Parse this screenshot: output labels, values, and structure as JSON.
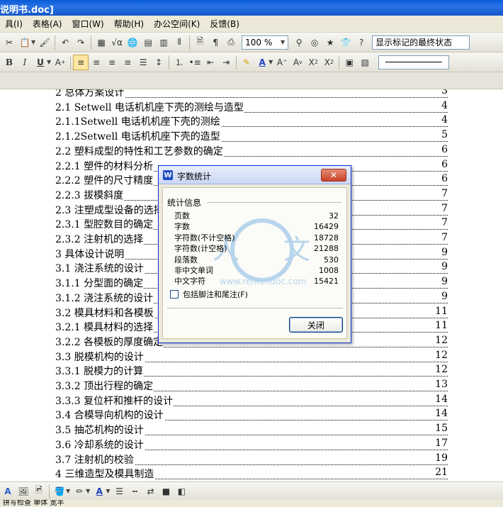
{
  "window": {
    "title": "说明书.doc]"
  },
  "menu": [
    "具(I)",
    "表格(A)",
    "窗口(W)",
    "帮助(H)",
    "办公空间(K)",
    "反馈(B)"
  ],
  "toolbar": {
    "zoom": "100 %",
    "markup_view": "显示标记的最终状态"
  },
  "toc": [
    {
      "text": "2 总体方案设计",
      "page": "3"
    },
    {
      "text": "2.1  Setwell 电话机机座下壳的测绘与造型",
      "page": "4"
    },
    {
      "text": "2.1.1Setwell 电话机机座下壳的测绘",
      "page": "4"
    },
    {
      "text": "2.1.2Setwell 电话机机座下壳的造型",
      "page": "5"
    },
    {
      "text": "2.2 塑料成型的特性和工艺参数的确定",
      "page": "6"
    },
    {
      "text": "2.2.1 塑件的材料分析",
      "page": "6"
    },
    {
      "text": "2.2.2 塑件的尺寸精度",
      "page": "6"
    },
    {
      "text": "2.2.3 拔模斜度",
      "page": "7"
    },
    {
      "text": "2.3 注塑成型设备的选择",
      "page": "7"
    },
    {
      "text": "2.3.1 型腔数目的确定",
      "page": "7"
    },
    {
      "text": "2.3.2 注射机的选择",
      "page": "7"
    },
    {
      "text": "3 具体设计说明",
      "page": "9"
    },
    {
      "text": "3.1 浇注系统的设计",
      "page": "9"
    },
    {
      "text": "3.1.1 分型面的确定",
      "page": "9"
    },
    {
      "text": "3.1.2 浇注系统的设计",
      "page": "9"
    },
    {
      "text": "3.2 模具材料和各模板",
      "page": "11"
    },
    {
      "text": "3.2.1 模具材料的选择",
      "page": "11"
    },
    {
      "text": "3.2.2  各模板的厚度确定",
      "page": "12"
    },
    {
      "text": "3.3 脱模机构的设计",
      "page": "12"
    },
    {
      "text": "3.3.1 脱模力的计算",
      "page": "12"
    },
    {
      "text": "3.3.2 顶出行程的确定",
      "page": "13"
    },
    {
      "text": "3.3.3 复位杆和推杆的设计",
      "page": "14"
    },
    {
      "text": "3.4 合模导向机构的设计",
      "page": "14"
    },
    {
      "text": "3.5 抽芯机构的设计",
      "page": "15"
    },
    {
      "text": "3.6 冷却系统的设计",
      "page": "17"
    },
    {
      "text": "3.7 注射机的校验",
      "page": "19"
    },
    {
      "text": "4 三维造型及模具制造",
      "page": "21"
    }
  ],
  "dialog": {
    "title": "字数统计",
    "group_label": "统计信息",
    "stats": [
      {
        "label": "页数",
        "value": "32"
      },
      {
        "label": "字数",
        "value": "16429"
      },
      {
        "label": "字符数(不计空格)",
        "value": "18728"
      },
      {
        "label": "字符数(计空格)",
        "value": "21288"
      },
      {
        "label": "段落数",
        "value": "530"
      },
      {
        "label": "非中文单词",
        "value": "1008"
      },
      {
        "label": "中文字符",
        "value": "15421"
      }
    ],
    "checkbox_label": "包括脚注和尾注(F)",
    "close_label": "关闭",
    "watermark_url": "www.renrendoc.com"
  },
  "status": {
    "text": "拼写检查   单体   宽半"
  },
  "colors": {
    "accent": "#316ac5",
    "dialog_border": "#0831d9",
    "close_red": "#c9442a"
  }
}
